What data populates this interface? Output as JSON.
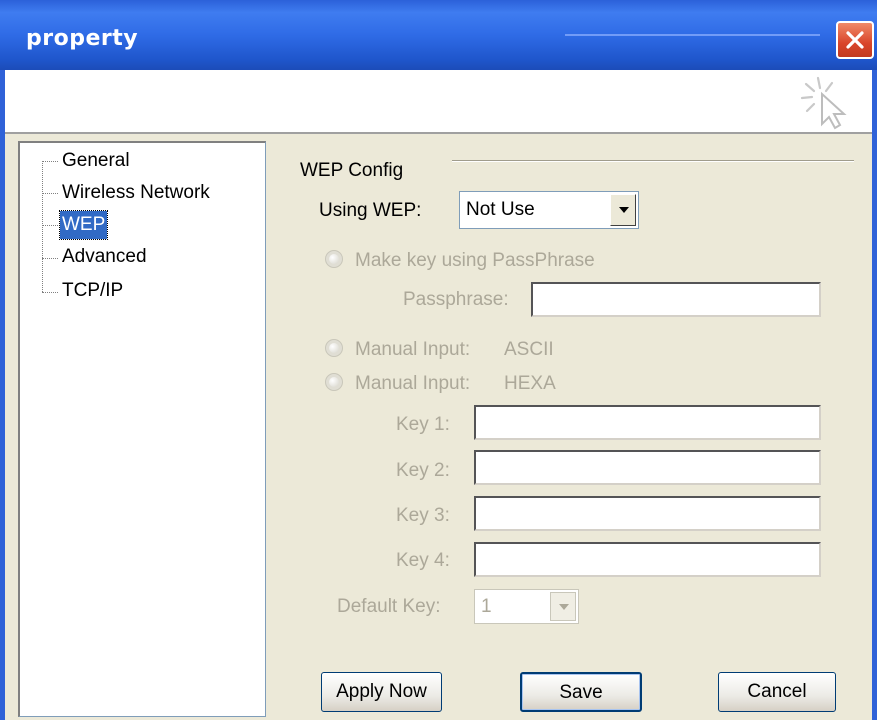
{
  "window": {
    "title": "property"
  },
  "tree": {
    "items": [
      {
        "label": "General",
        "selected": false
      },
      {
        "label": "Wireless Network",
        "selected": false
      },
      {
        "label": "WEP",
        "selected": true
      },
      {
        "label": "Advanced",
        "selected": false
      },
      {
        "label": "TCP/IP",
        "selected": false
      }
    ]
  },
  "wep": {
    "group_label": "WEP Config",
    "using_label": "Using WEP:",
    "using_value": "Not Use",
    "passphrase_radio": "Make key using PassPhrase",
    "passphrase_label": "Passphrase:",
    "passphrase_value": "",
    "manual_label_1": "Manual Input:",
    "manual_type_1": "ASCII",
    "manual_label_2": "Manual Input:",
    "manual_type_2": "HEXA",
    "keys": [
      {
        "label": "Key 1:",
        "value": ""
      },
      {
        "label": "Key 2:",
        "value": ""
      },
      {
        "label": "Key 3:",
        "value": ""
      },
      {
        "label": "Key 4:",
        "value": ""
      }
    ],
    "default_key_label": "Default Key:",
    "default_key_value": "1"
  },
  "buttons": {
    "apply": "Apply Now",
    "save": "Save",
    "cancel": "Cancel"
  },
  "icons": {
    "close": "close-icon",
    "logo": "cursor-sparkle-icon",
    "dropdown": "chevron-down-icon"
  },
  "colors": {
    "titlebar": "#2f6be6",
    "selection": "#316ac5",
    "face": "#ece9d8",
    "disabled_text": "#aca899"
  }
}
